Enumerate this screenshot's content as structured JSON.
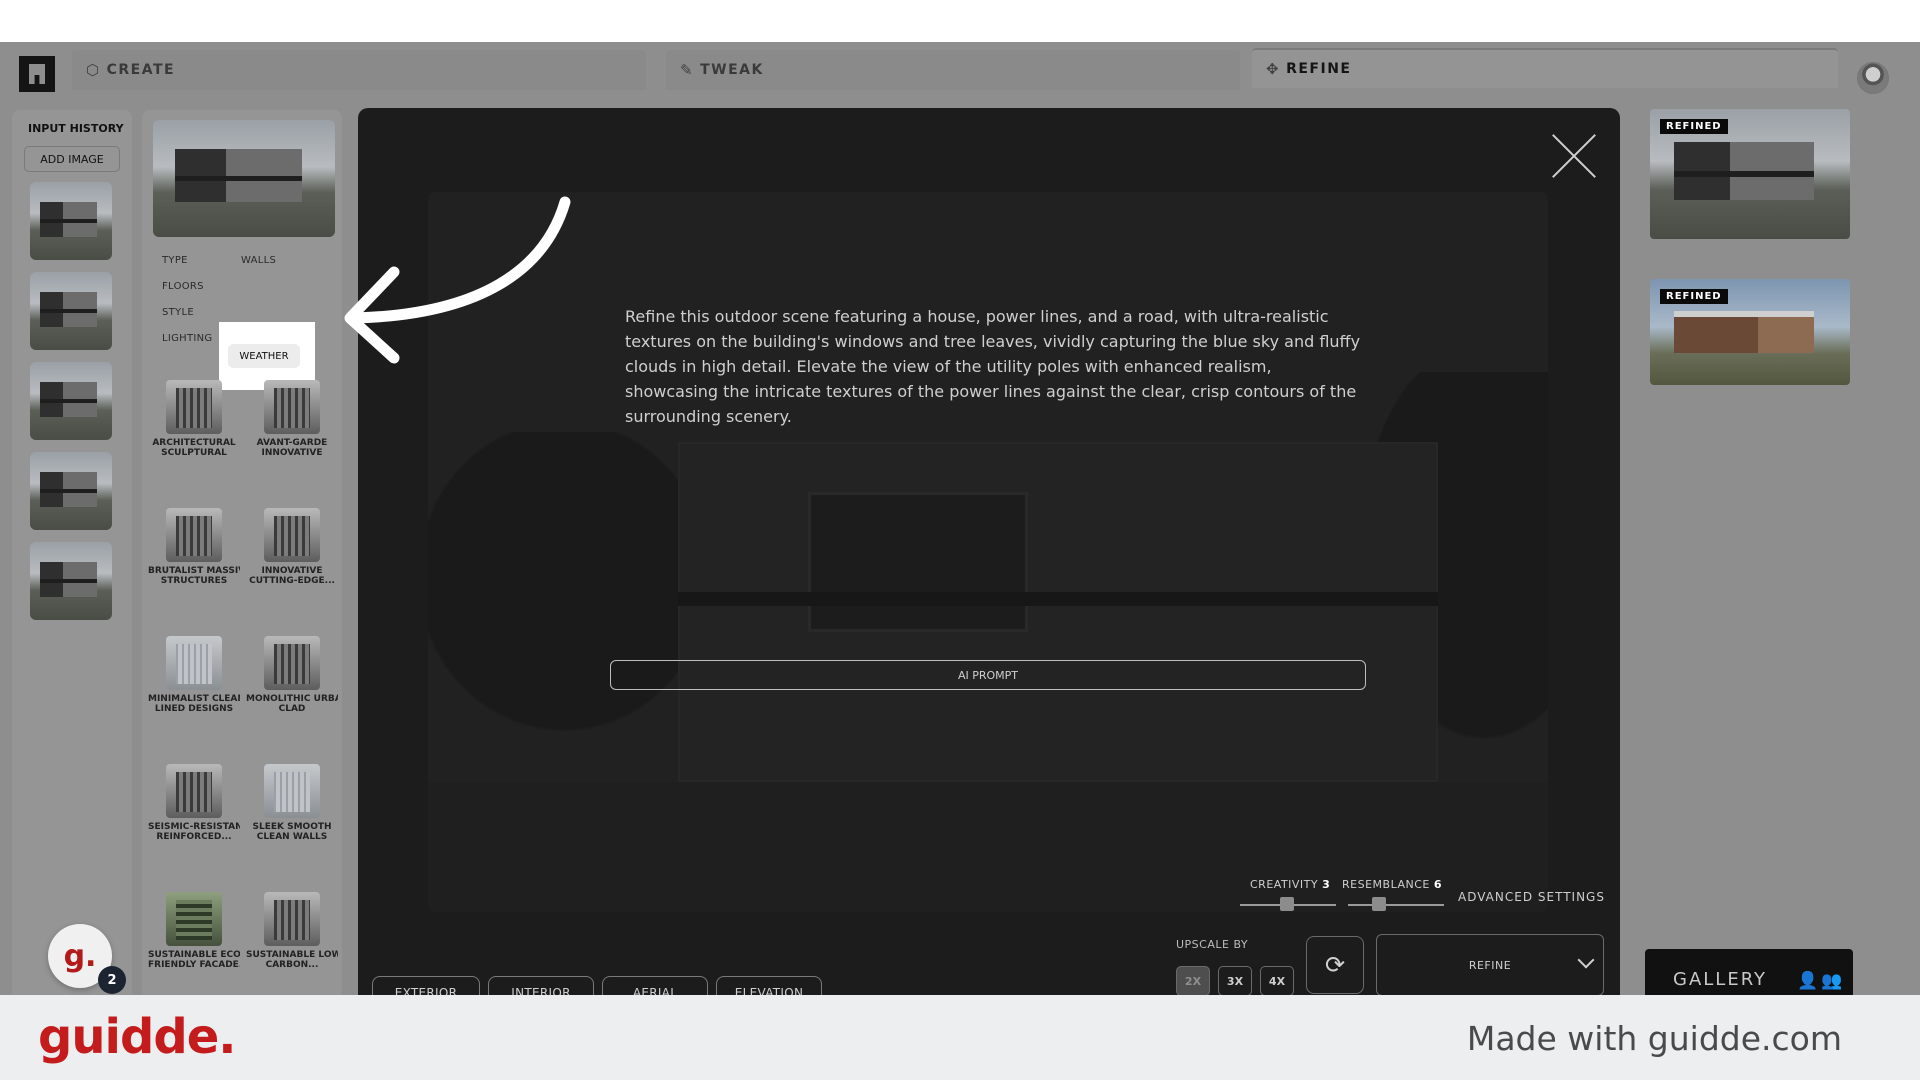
{
  "tabs": [
    {
      "label": "CREATE",
      "icon": "cube-icon"
    },
    {
      "label": "TWEAK",
      "icon": "brush-icon"
    },
    {
      "label": "REFINE",
      "icon": "target-icon"
    }
  ],
  "input_history": {
    "title": "INPUT HISTORY",
    "add_label": "ADD IMAGE"
  },
  "categories": {
    "type": "TYPE",
    "walls": "WALLS",
    "floors": "FLOORS",
    "style": "STYLE",
    "weather": "WEATHER",
    "lighting": "LIGHTING"
  },
  "style_tiles": [
    {
      "label1": "ARCHITECTURAL",
      "label2": "SCULPTURAL"
    },
    {
      "label1": "AVANT-GARDE",
      "label2": "INNOVATIVE"
    },
    {
      "label1": "BRUTALIST MASSIVE",
      "label2": "STRUCTURES"
    },
    {
      "label1": "INNOVATIVE",
      "label2": "CUTTING-EDGE..."
    },
    {
      "label1": "MINIMALIST CLEAN-",
      "label2": "LINED DESIGNS"
    },
    {
      "label1": "MONOLITHIC URBAN",
      "label2": "CLAD"
    },
    {
      "label1": "SEISMIC-RESISTANT",
      "label2": "REINFORCED..."
    },
    {
      "label1": "SLEEK SMOOTH",
      "label2": "CLEAN WALLS"
    },
    {
      "label1": "SUSTAINABLE ECO-",
      "label2": "FRIENDLY FACADE..."
    },
    {
      "label1": "SUSTAINABLE LOW-",
      "label2": "CARBON..."
    }
  ],
  "modal": {
    "prompt_text": "Refine this outdoor scene featuring a house, power lines, and a road, with ultra-realistic textures on the building's windows and tree leaves, vividly capturing the blue sky and fluffy clouds in high detail. Elevate the view of the utility poles with enhanced realism, showcasing the intricate textures of the power lines against the clear, crisp contours of the surrounding scenery.",
    "ai_prompt_label": "AI PROMPT",
    "creativity_label": "CREATIVITY",
    "creativity_value": "3",
    "resemblance_label": "RESEMBLANCE",
    "resemblance_value": "6",
    "advanced_label": "ADVANCED SETTINGS",
    "upscale_label": "UPSCALE BY",
    "upscale_options": [
      "2X",
      "3X",
      "4X"
    ],
    "upscale_selected": "2X",
    "refine_label": "REFINE",
    "view_buttons": [
      "EXTERIOR",
      "INTERIOR",
      "AERIAL",
      "ELEVATION"
    ]
  },
  "refined_badge": "REFINED",
  "gallery_label": "GALLERY",
  "guidde": {
    "bubble_letter": "g.",
    "count": "2",
    "logo": "guidde.",
    "made_with": "Made with guidde.com"
  }
}
